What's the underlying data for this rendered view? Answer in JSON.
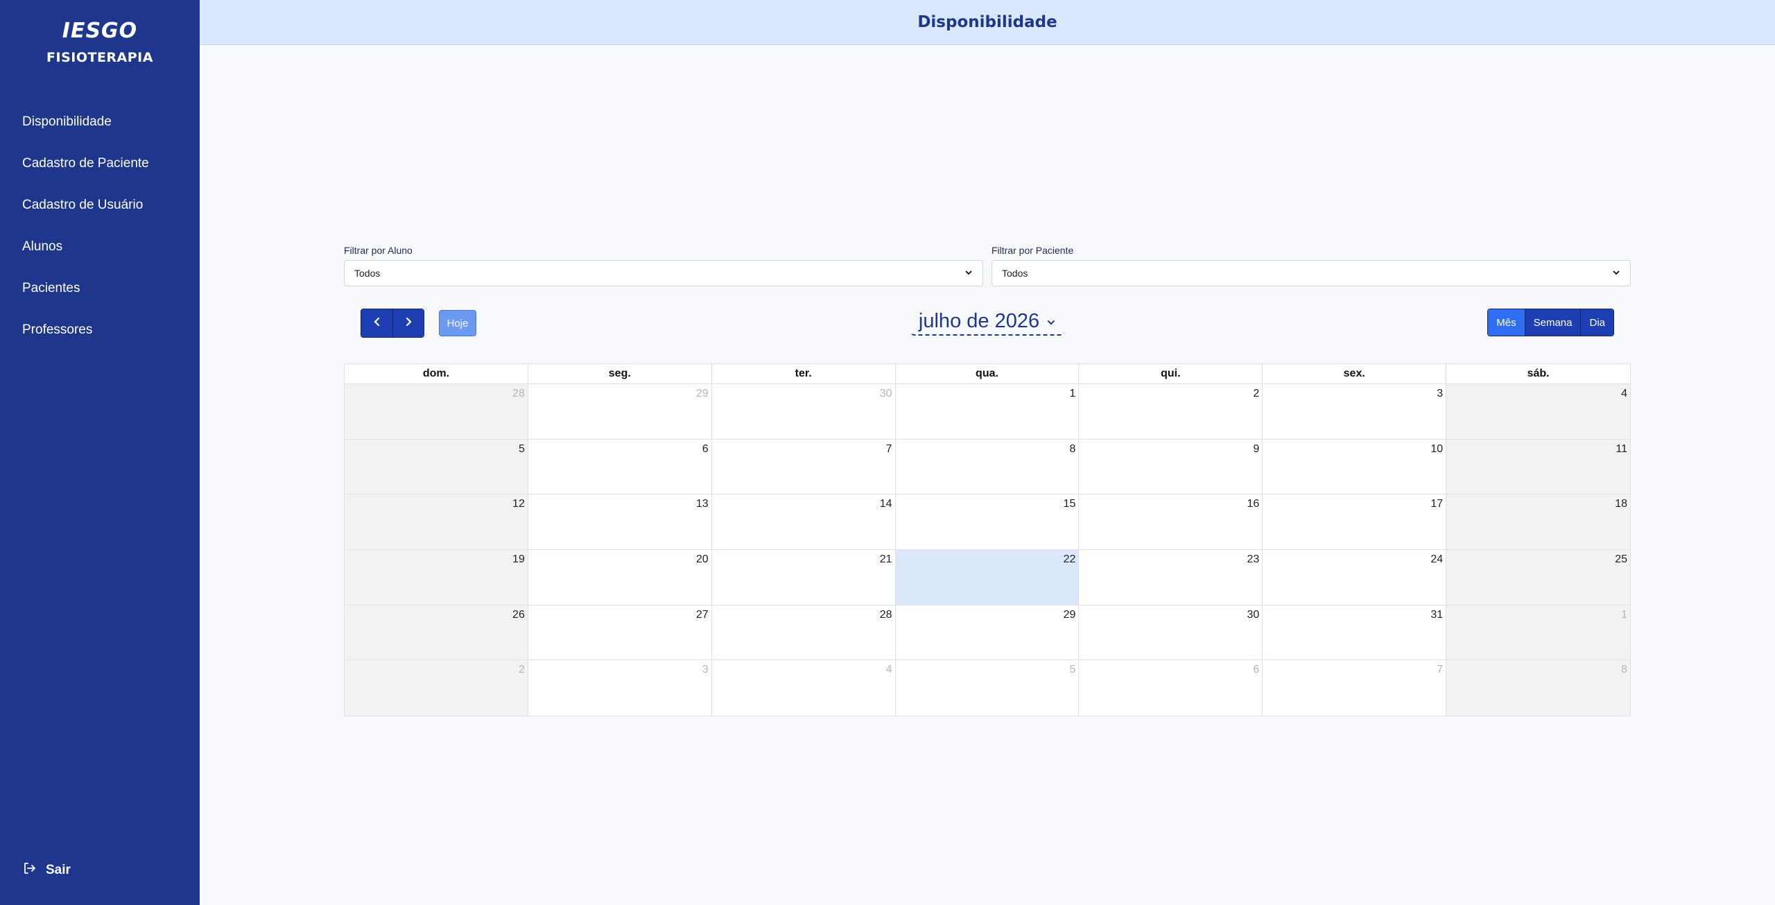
{
  "sidebar": {
    "logo_text": "IESGO",
    "brand_subtitle": "FISIOTERAPIA",
    "items": [
      {
        "label": "Disponibilidade"
      },
      {
        "label": "Cadastro de Paciente"
      },
      {
        "label": "Cadastro de Usuário"
      },
      {
        "label": "Alunos"
      },
      {
        "label": "Pacientes"
      },
      {
        "label": "Professores"
      }
    ],
    "logout_label": "Sair"
  },
  "header": {
    "title": "Disponibilidade"
  },
  "filters": {
    "aluno": {
      "label": "Filtrar por Aluno",
      "value": "Todos"
    },
    "paciente": {
      "label": "Filtrar por Paciente",
      "value": "Todos"
    }
  },
  "toolbar": {
    "today_label": "Hoje",
    "month_title": "julho de 2026",
    "views": [
      "Mês",
      "Semana",
      "Dia"
    ],
    "active_view": "Mês"
  },
  "calendar": {
    "weekdays": [
      "dom.",
      "seg.",
      "ter.",
      "qua.",
      "qui.",
      "sex.",
      "sáb."
    ],
    "today": 22,
    "weeks": [
      [
        {
          "d": "28",
          "o": true
        },
        {
          "d": "29",
          "o": true
        },
        {
          "d": "30",
          "o": true
        },
        {
          "d": "1"
        },
        {
          "d": "2"
        },
        {
          "d": "3"
        },
        {
          "d": "4"
        }
      ],
      [
        {
          "d": "5"
        },
        {
          "d": "6"
        },
        {
          "d": "7"
        },
        {
          "d": "8"
        },
        {
          "d": "9"
        },
        {
          "d": "10"
        },
        {
          "d": "11"
        }
      ],
      [
        {
          "d": "12"
        },
        {
          "d": "13"
        },
        {
          "d": "14"
        },
        {
          "d": "15"
        },
        {
          "d": "16"
        },
        {
          "d": "17"
        },
        {
          "d": "18"
        }
      ],
      [
        {
          "d": "19"
        },
        {
          "d": "20"
        },
        {
          "d": "21"
        },
        {
          "d": "22"
        },
        {
          "d": "23"
        },
        {
          "d": "24"
        },
        {
          "d": "25"
        }
      ],
      [
        {
          "d": "26"
        },
        {
          "d": "27"
        },
        {
          "d": "28"
        },
        {
          "d": "29"
        },
        {
          "d": "30"
        },
        {
          "d": "31"
        },
        {
          "d": "1",
          "o": true
        }
      ],
      [
        {
          "d": "2",
          "o": true
        },
        {
          "d": "3",
          "o": true
        },
        {
          "d": "4",
          "o": true
        },
        {
          "d": "5",
          "o": true
        },
        {
          "d": "6",
          "o": true
        },
        {
          "d": "7",
          "o": true
        },
        {
          "d": "8",
          "o": true
        }
      ]
    ]
  },
  "colors": {
    "sidebar_bg": "#1e378c",
    "header_bg": "#d9e8fc",
    "primary_button": "#1e3fb4",
    "active_view": "#2f6ef0",
    "today_cell": "#dbe8fb",
    "weekend_cell": "#f2f2f2"
  }
}
